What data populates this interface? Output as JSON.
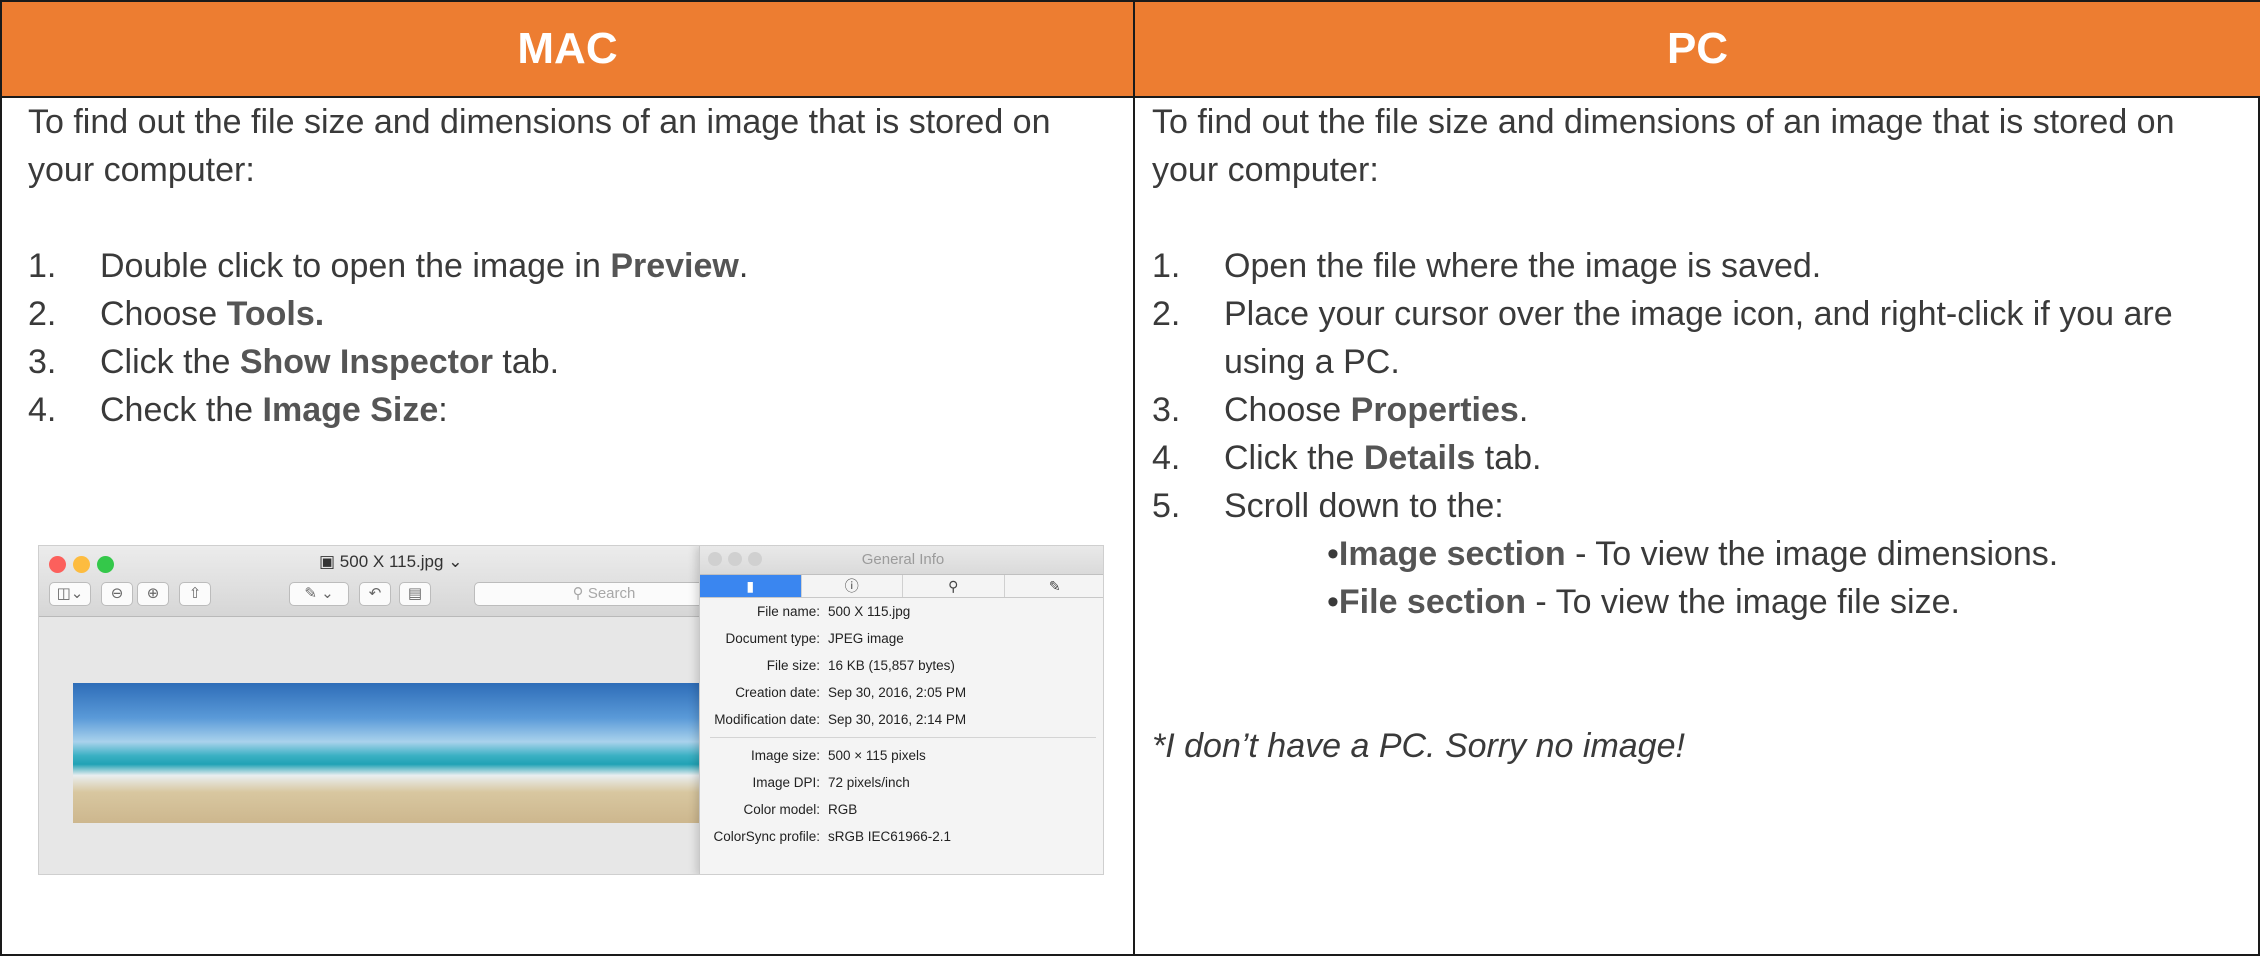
{
  "headers": {
    "mac": "MAC",
    "pc": "PC"
  },
  "mac": {
    "intro": "To find out the file size and dimensions of an image that is stored on your computer:",
    "steps": [
      {
        "n": "1.",
        "pre": "Double click to open the image in ",
        "bold": "Preview",
        "post": "."
      },
      {
        "n": "2.",
        "pre": "Choose ",
        "bold": "Tools.",
        "post": ""
      },
      {
        "n": "3.",
        "pre": "Click the ",
        "bold": "Show Inspector",
        "post": " tab."
      },
      {
        "n": "4.",
        "pre": "Check the ",
        "bold": "Image Size",
        "post": ":"
      }
    ],
    "screenshot": {
      "window_title": "500 X 115.jpg",
      "search_placeholder": "Search",
      "inspector_title": "General Info",
      "tab_icons": [
        "document-icon",
        "info-icon",
        "magnifier-icon",
        "pencil-icon"
      ],
      "info_group1": [
        {
          "k": "File name:",
          "v": "500 X 115.jpg"
        },
        {
          "k": "Document type:",
          "v": "JPEG image"
        },
        {
          "k": "File size:",
          "v": "16 KB (15,857 bytes)"
        },
        {
          "k": "Creation date:",
          "v": "Sep 30, 2016, 2:05 PM"
        },
        {
          "k": "Modification date:",
          "v": "Sep 30, 2016, 2:14 PM"
        }
      ],
      "info_group2": [
        {
          "k": "Image size:",
          "v": "500 × 115 pixels"
        },
        {
          "k": "Image DPI:",
          "v": "72 pixels/inch"
        },
        {
          "k": "Color model:",
          "v": "RGB"
        },
        {
          "k": "ColorSync profile:",
          "v": "sRGB IEC61966-2.1"
        }
      ]
    }
  },
  "pc": {
    "intro": "To find out the file size and dimensions of an image that is stored on your computer:",
    "steps": [
      {
        "n": "1.",
        "pre": "Open the file where the image is saved.",
        "bold": "",
        "post": ""
      },
      {
        "n": "2.",
        "pre": "Place your cursor over the image icon, and right-click if you are using a PC.",
        "bold": "",
        "post": ""
      },
      {
        "n": "3.",
        "pre": "Choose ",
        "bold": "Properties",
        "post": "."
      },
      {
        "n": "4.",
        "pre": "Click the ",
        "bold": "Details",
        "post": " tab."
      },
      {
        "n": "5.",
        "pre": "Scroll down to the:",
        "bold": "",
        "post": ""
      }
    ],
    "subitems": [
      {
        "bullet": "•",
        "bold": "Image section",
        "post": " -  To view the image dimensions."
      },
      {
        "bullet": "•",
        "bold": "File section",
        "post": " - To view the image file size."
      }
    ],
    "note": "*I don’t have a PC. Sorry no image!"
  },
  "colors": {
    "header_bg": "#ed7d31",
    "header_text": "#ffffff",
    "border": "#1a1a1a"
  }
}
